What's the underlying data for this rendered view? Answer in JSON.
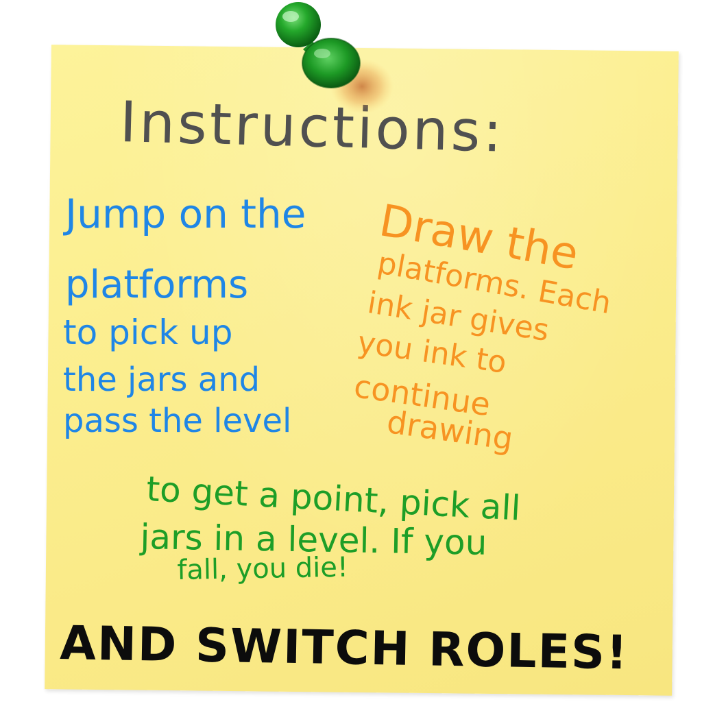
{
  "note": {
    "title": "Instructions:",
    "jumper_lines": [
      "Jump on the",
      "platforms",
      "to pick up",
      "the jars and",
      "pass the level"
    ],
    "drawer_lines": [
      "Draw the",
      "platforms. Each",
      "ink jar gives",
      "you ink to",
      "continue",
      "drawing"
    ],
    "goal_lines": [
      "to get a point, pick all",
      "jars in a level. If you",
      "fall, you die!"
    ],
    "switch_line": "AND SWITCH ROLES!"
  },
  "colors": {
    "note": "#fbed8d",
    "title": "#505050",
    "jumper": "#1f86e6",
    "drawer": "#f79322",
    "goal": "#1d9e27",
    "switch": "#0c0c0c",
    "pin": "#22a62a"
  },
  "icons": {
    "pin": "green-pushpin-icon"
  }
}
